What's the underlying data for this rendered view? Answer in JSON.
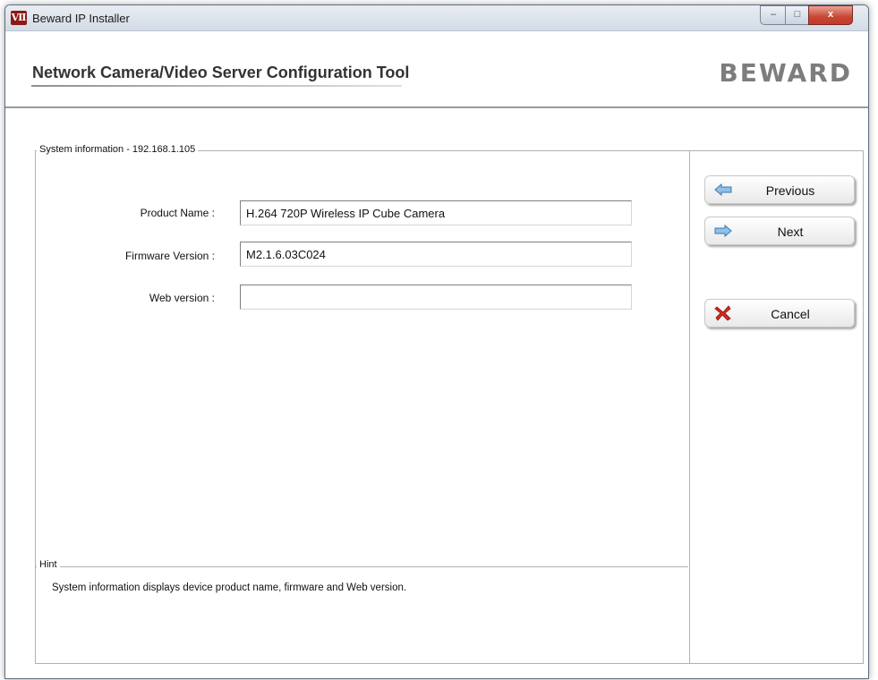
{
  "window": {
    "title": "Beward IP Installer",
    "controls": {
      "minimize": "–",
      "maximize": "□",
      "close": "x"
    }
  },
  "header": {
    "title": "Network Camera/Video Server Configuration Tool",
    "logo": "BEWARD"
  },
  "system_info": {
    "legend": "System information - 192.168.1.105",
    "fields": [
      {
        "label": "Product Name :",
        "value": "H.264 720P Wireless IP Cube Camera"
      },
      {
        "label": "Firmware Version :",
        "value": "M2.1.6.03C024"
      },
      {
        "label": "Web version :",
        "value": ""
      }
    ]
  },
  "hint": {
    "legend": "Hint",
    "text": "System information displays device product name, firmware and Web version."
  },
  "buttons": {
    "previous": "Previous",
    "next": "Next",
    "cancel": "Cancel"
  },
  "colors": {
    "arrow": "#5b9bd5",
    "cancel_x": "#c8231b"
  }
}
